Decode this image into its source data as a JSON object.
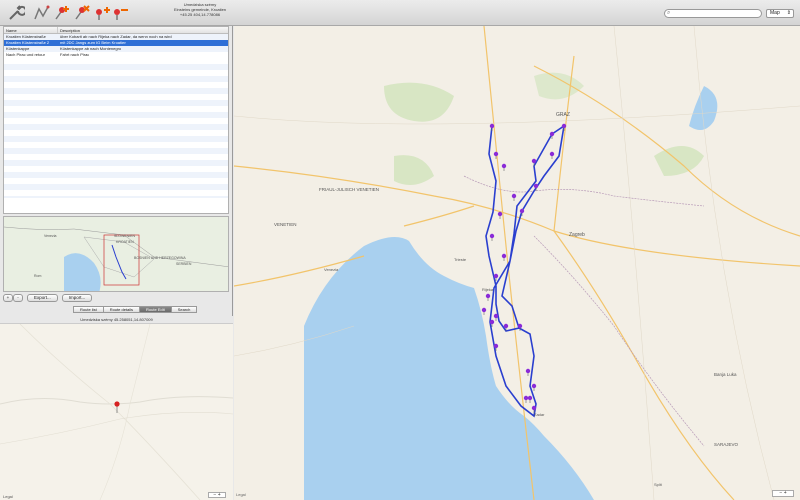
{
  "toolbar": {
    "title_lines": [
      "Umedziska szémy",
      "Einsteins gemeinde, Kroatien",
      "+45.25 404,14.778086"
    ],
    "search_placeholder": "",
    "map_type": "Map"
  },
  "table": {
    "columns": [
      "Name",
      "Description"
    ],
    "rows": [
      {
        "name": "Kroatien Küstenstraße",
        "desc": "über Kobarit ab nach Rijeka nach Zadar, da wenn noch na wird",
        "selected": false
      },
      {
        "name": "Kroatien Küstenstraße 2",
        "desc": "mit 2DC Jangs zum IG Beim Kroatien",
        "selected": true
      },
      {
        "name": "Küstenkappe",
        "desc": "Küstenkappe ab nach Montenegro",
        "selected": false
      },
      {
        "name": "Nach Pirac und retour",
        "desc": "Fahrt nach Pirac",
        "selected": false
      }
    ]
  },
  "buttons": {
    "add": "+",
    "remove": "-",
    "export": "Export...",
    "import": "Import..."
  },
  "tabs": [
    "Route list",
    "Route details",
    "Route Edit",
    "Search"
  ],
  "coords_text": "Umedziska szémy 45.258051,14.807009",
  "minimap_labels": [
    "SLOWENIEN",
    "KROATIEN",
    "BOSNIEN UND HERZEGOWINA",
    "SERBIEN",
    "Venezia",
    "Rom"
  ],
  "map_labels": {
    "cities": [
      "GRAZ",
      "Zagreb",
      "Rijeka",
      "Trieste",
      "Venezia",
      "Banja Luka",
      "SARAJEVO",
      "Zadar",
      "Split"
    ],
    "regions": [
      "FRIAUL-JULISCH VENETIEN",
      "VENETIEN"
    ]
  },
  "legal": {
    "left": "Legal",
    "map": "Legal"
  },
  "zoom": {
    "minus": "−",
    "plus": "+"
  },
  "colors": {
    "route": "#2a3fcf",
    "pin": "#8a2bd8",
    "water": "#a9d0ef",
    "selected": "#2f6fd6"
  }
}
